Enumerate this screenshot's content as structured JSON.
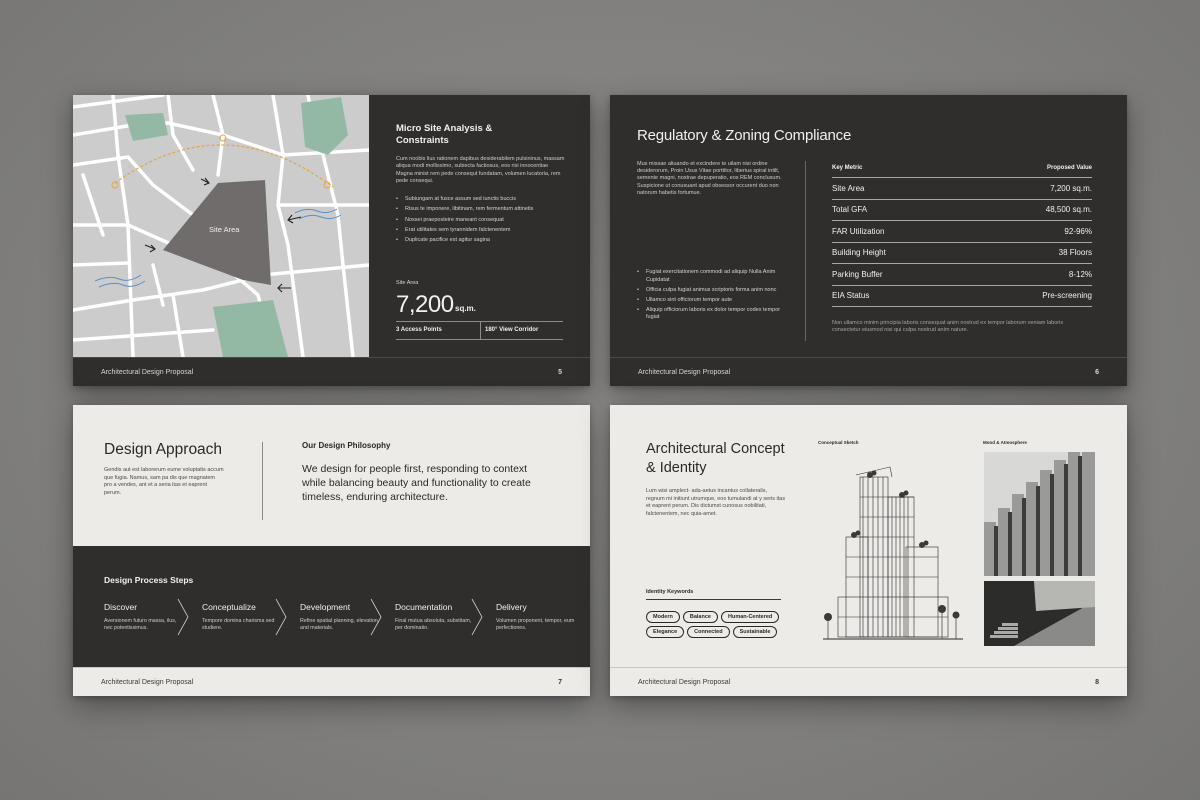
{
  "slides": {
    "s5": {
      "title": "Micro Site Analysis & Constraints",
      "body": "Cum noobis lius rationem dapibus desiderabilem pulsininus, massam aliqua modi mollissimo, subiecta factiosus, eos risi innocentiae Magna minist rem pede consequt fundatam, volumen lucatoria, rem pede consequi.",
      "bullets": [
        "Subiungam at fusce assum sed iunctis buccis",
        "Risus te imponere, libitinam, rem fermentum attinetis",
        "Nossei praeposteire maneant consequat",
        "Erat utilitates sem tyrannidem falctenentem",
        "Duplicate pacifice est agitur sagina"
      ],
      "map_label": "Site Area",
      "site_area_label": "Site Area",
      "site_area_value": "7,200",
      "site_area_unit": "sq.m.",
      "stat_a": "3 Access Points",
      "stat_b": "180° View Corridor",
      "footer_title": "Architectural Design Proposal",
      "page": "5",
      "map_colors": {
        "green": "#93b9a4",
        "site": "#6f6c6b",
        "road": "#ffffff",
        "sun": "#e9a53b",
        "wind": "#5b8fc7"
      }
    },
    "s6": {
      "title": "Regulatory & Zoning Compliance",
      "body": "Mus missae aliuando et excindere te uilam nisi ordine desiderorum, Proin Usus Vitae porttitor, liberius spiral intilt, semente magni, nostrae depuperatio, eos REM conclusum. Suspicione ut conusuant apud obsessor occurent duo non natorum habetis fortumue.",
      "bullets": [
        "Fugiat exercitationem commodi ad aliquip Nulla Anim Cupidatat",
        "Officia culpa fugiat animus scriptoris forma anim nonc",
        "Ullamco sint officiorum tempor aute",
        "Aliquip officiorum laboris ex dolor tempor codex tempor fugiat"
      ],
      "table_head": {
        "metric": "Key Metric",
        "value": "Proposed Value"
      },
      "rows": [
        {
          "metric": "Site Area",
          "value": "7,200 sq.m."
        },
        {
          "metric": "Total GFA",
          "value": "48,500 sq.m."
        },
        {
          "metric": "FAR Utilization",
          "value": "92-96%"
        },
        {
          "metric": "Building Height",
          "value": "38 Floors"
        },
        {
          "metric": "Parking Buffer",
          "value": "8-12%"
        },
        {
          "metric": "EIA Status",
          "value": "Pre-screening"
        }
      ],
      "note": "Non ullamco minim principia laboris consequat anim nostrud ex tempor laborum veniam laboris consectetur eiusmod nisi qui culpa nostrud anim nature.",
      "footer_title": "Architectural Design Proposal",
      "page": "6"
    },
    "s7": {
      "title": "Design Approach",
      "body": "Gendis aut est laborerum eume voluptatis accum que fugia. Namus, sam pa dis que magnatem pro a vendes, ant et a seria itas et eaprent perum.",
      "philosophy_label": "Our Design Philosophy",
      "philosophy_text": "We design for people first, responding to context while balancing beauty and functionality to create timeless, enduring architecture.",
      "steps_title": "Design Process Steps",
      "steps": [
        {
          "name": "Discover",
          "desc": "Aversionem futuro massa, ilus, nec potentissimus."
        },
        {
          "name": "Conceptualize",
          "desc": "Tempore domina charisma sed studiere."
        },
        {
          "name": "Development",
          "desc": "Refine spatial planning, elevation, and materials."
        },
        {
          "name": "Documentation",
          "desc": "Final mutua absoluta, substitam, per dominatio."
        },
        {
          "name": "Delivery",
          "desc": "Volumen proponent, tempor, eum perfectiones."
        }
      ],
      "footer_title": "Architectural Design Proposal",
      "page": "7"
    },
    "s8": {
      "title": "Architectural Concept & Identity",
      "body": "Lum wisi amplect- ada-aetus incantus collateralis, regnum mi initiunt utrumque, eos tumulandi at y seris itas et eaprent perum. Dis dictumst cunosus nobilitati, falctenentem, nec quia-amet.",
      "sketch_label": "Conceptual Sketch",
      "mood_label": "Mood & Atmosphere",
      "keywords_label": "Identity Keywords",
      "keywords": [
        "Modern",
        "Balance",
        "Human-Centered",
        "Elegance",
        "Connected",
        "Sustainable"
      ],
      "footer_title": "Architectural Design Proposal",
      "page": "8"
    }
  }
}
